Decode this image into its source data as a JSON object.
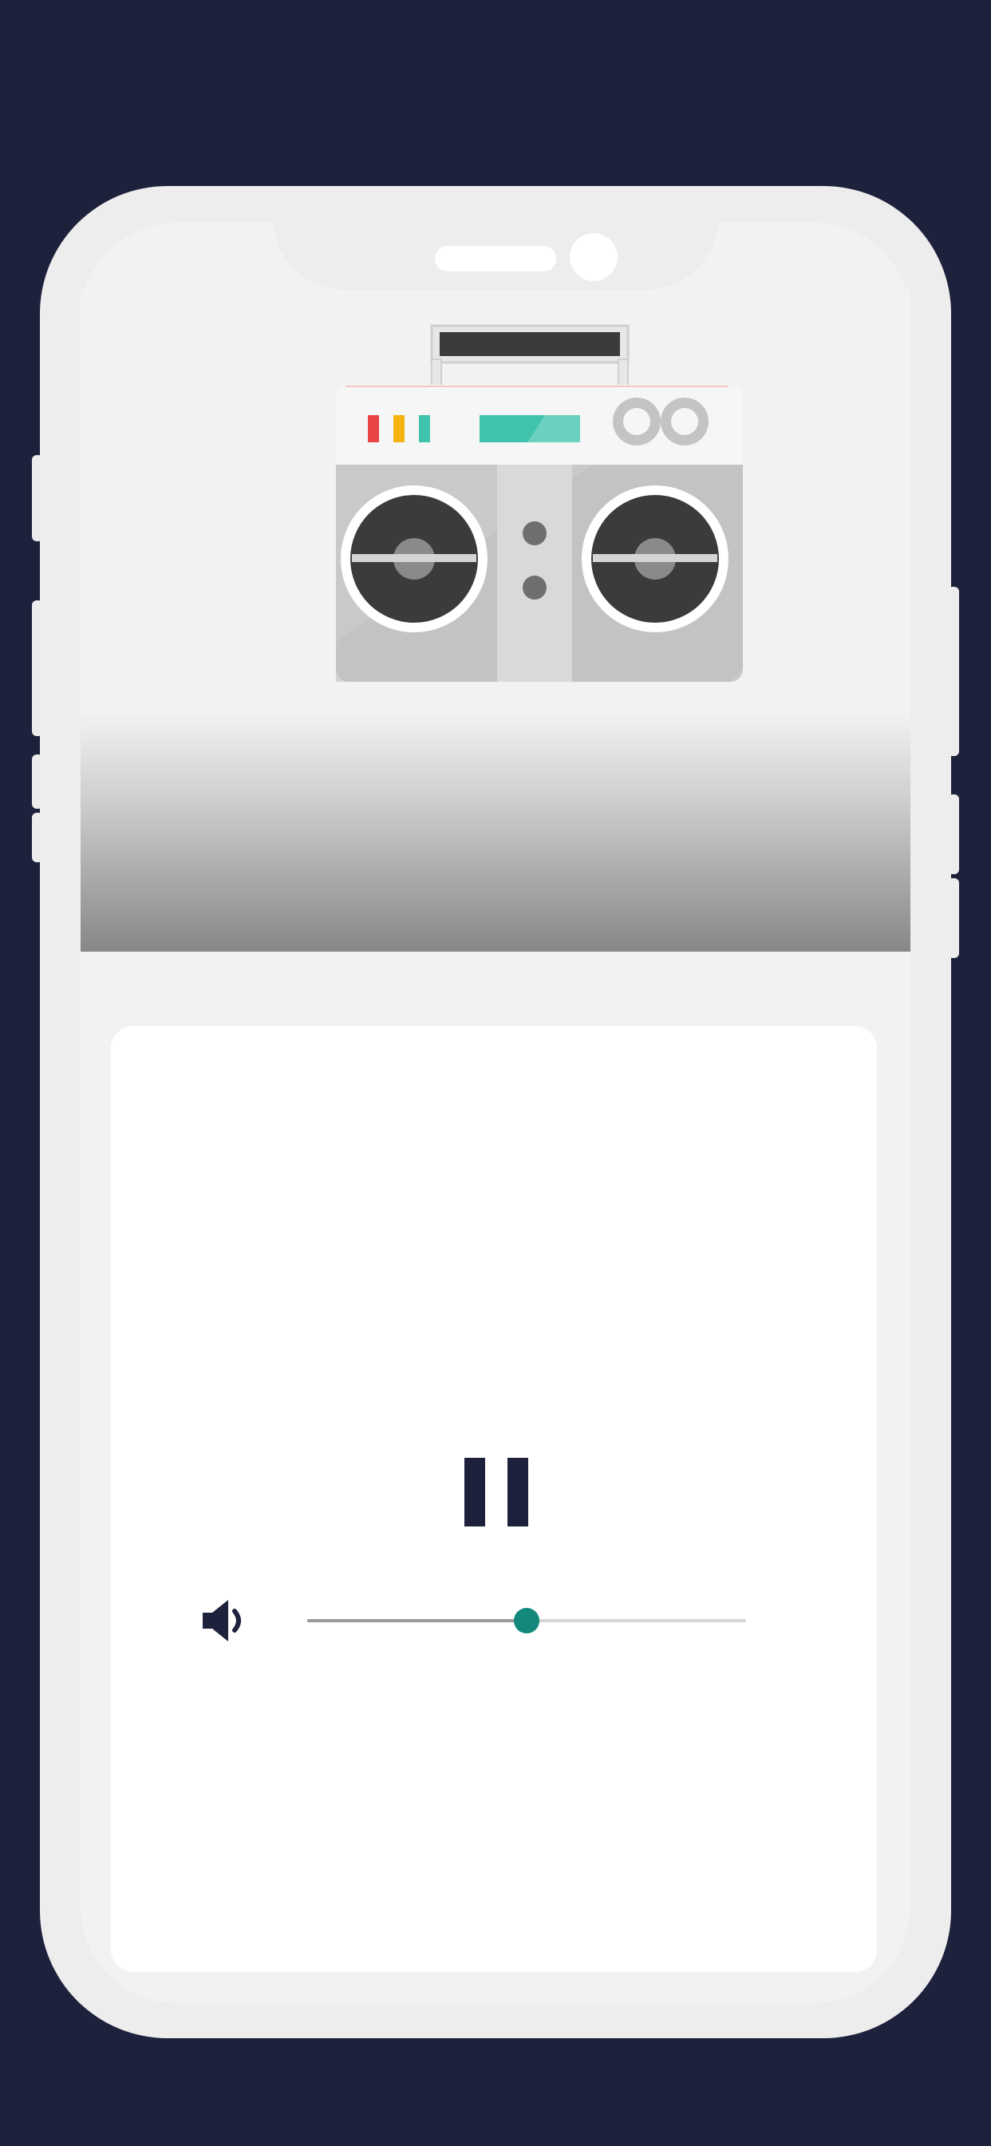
{
  "player": {
    "state": "playing",
    "pause_icon": "pause-icon",
    "volume_icon": "volume-icon",
    "volume_level": 0.5
  },
  "artwork": {
    "icon": "boombox-icon"
  },
  "colors": {
    "background": "#1e213b",
    "accent": "#12897a",
    "boombox_teal": "#3fc3ac",
    "boombox_red": "#e94545",
    "boombox_yellow": "#f4b40f",
    "control_dark": "#1e213b"
  }
}
